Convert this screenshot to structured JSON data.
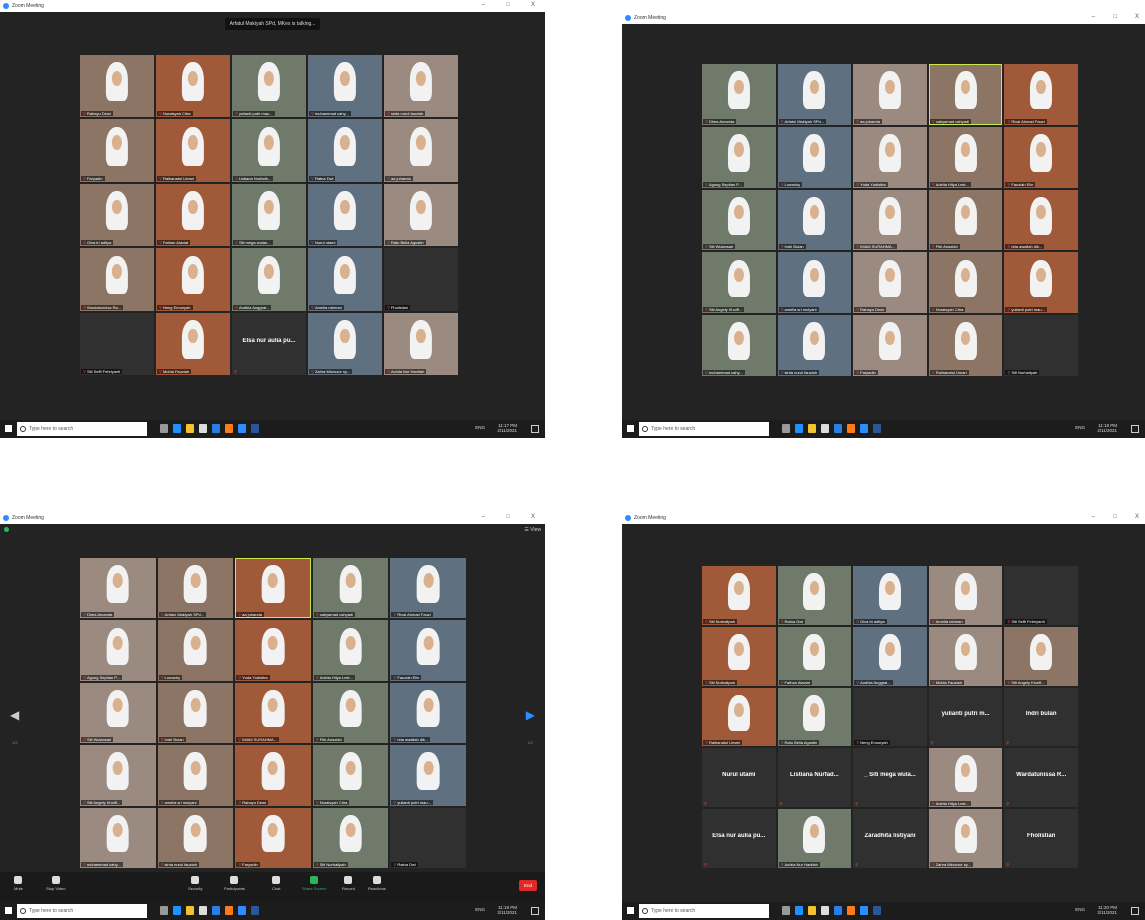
{
  "app_title": "Zoom Meeting",
  "window_controls": [
    "–",
    "□",
    "X"
  ],
  "taskbar": {
    "search_placeholder": "Type here to search",
    "lang": "ENG",
    "times": [
      "11:17 PM",
      "11:18 PM",
      "11:19 PM",
      "11:20 PM"
    ],
    "date": "2/11/2021"
  },
  "screens": [
    {
      "talking": "Arfatul Makiyah SPd, MKes is talking...",
      "tiles": [
        {
          "name": "Rahayu Dewi",
          "t": "video"
        },
        {
          "name": "Nuraisyah Citra",
          "t": "video"
        },
        {
          "name": "yulianti putri mau...",
          "t": "video"
        },
        {
          "name": "muhammad cahy...",
          "t": "video"
        },
        {
          "name": "sinta nurul fauziah",
          "t": "video"
        },
        {
          "name": "Faryadin",
          "t": "video"
        },
        {
          "name": "Raihanatul Umari",
          "t": "video"
        },
        {
          "name": "Listiana Nurfadh...",
          "t": "video"
        },
        {
          "name": "Ratna Dwi",
          "t": "video"
        },
        {
          "name": "aa juhanda",
          "t": "video"
        },
        {
          "name": "Giva tri aditya",
          "t": "video"
        },
        {
          "name": "Fathan Alaviat",
          "t": "video"
        },
        {
          "name": "Siti mega wulan...",
          "t": "video"
        },
        {
          "name": "Nurul utami",
          "t": "video"
        },
        {
          "name": "Ratu Bella Agustin",
          "t": "video"
        },
        {
          "name": "Wardatunnisa Ra...",
          "t": "video"
        },
        {
          "name": "Neng Emunyah",
          "t": "video"
        },
        {
          "name": "Audhia Anggrai...",
          "t": "video"
        },
        {
          "name": "Amelia rahman",
          "t": "video"
        },
        {
          "name": "Fholistian",
          "t": "empty"
        },
        {
          "name": "Siti Seffi Febriyanti",
          "t": "empty"
        },
        {
          "name": "Muhia Fauziah",
          "t": "video"
        },
        {
          "name": "",
          "t": "text",
          "big": "Elsa nur aulia pu..."
        },
        {
          "name": "Zahra Mirzozur sy...",
          "t": "video"
        },
        {
          "name": "Achila Nur Hanifah",
          "t": "video"
        }
      ]
    },
    {
      "tiles": [
        {
          "name": "Dhea Amanda",
          "t": "video"
        },
        {
          "name": "Arfatul Makiyah SPd...",
          "t": "video"
        },
        {
          "name": "aa juhanda",
          "t": "video"
        },
        {
          "name": "cahyamad cahyadi",
          "t": "video",
          "active": true
        },
        {
          "name": "Rivai Ahmad Fauzi",
          "t": "video"
        },
        {
          "name": "Agung Septian P...",
          "t": "video"
        },
        {
          "name": "Louwcky",
          "t": "video"
        },
        {
          "name": "Yuda Yudistira",
          "t": "video"
        },
        {
          "name": "Adelia Hilya Lest...",
          "t": "video"
        },
        {
          "name": "Fauziah Elin",
          "t": "video"
        },
        {
          "name": "Siti Wulansari",
          "t": "video"
        },
        {
          "name": "Indri Bulan",
          "t": "video"
        },
        {
          "name": "IMAM SURAHMA...",
          "t": "video"
        },
        {
          "name": "Fitri Anazlah",
          "t": "video"
        },
        {
          "name": "rida awaliah dlk...",
          "t": "video"
        },
        {
          "name": "Siti Angely Khoiff...",
          "t": "video"
        },
        {
          "name": "amelia sri mulyani",
          "t": "video"
        },
        {
          "name": "Rahayu Dewi",
          "t": "video"
        },
        {
          "name": "Nuraisyah Citra",
          "t": "video"
        },
        {
          "name": "yulianti putri mau...",
          "t": "video"
        },
        {
          "name": "muhammad cahy...",
          "t": "video"
        },
        {
          "name": "sinta nurul fauziah",
          "t": "video"
        },
        {
          "name": "Faryadin",
          "t": "video"
        },
        {
          "name": "Raihanatul Umari",
          "t": "video"
        },
        {
          "name": "Siti Nurhalipah",
          "t": "empty"
        }
      ]
    },
    {
      "view_label": "View",
      "page": "1/2",
      "tiles": [
        {
          "name": "Dhea Amanda",
          "t": "video"
        },
        {
          "name": "Arfatul Makiyah SPd...",
          "t": "video"
        },
        {
          "name": "aa juhanda",
          "t": "video",
          "active": true
        },
        {
          "name": "cahyamad cahyadi",
          "t": "video"
        },
        {
          "name": "Rivai Ahmad Fauzi",
          "t": "video"
        },
        {
          "name": "Agung Septian P...",
          "t": "video"
        },
        {
          "name": "Louwcky",
          "t": "video"
        },
        {
          "name": "Yuda Yudistira",
          "t": "video"
        },
        {
          "name": "Adelia Hilya Lest...",
          "t": "video"
        },
        {
          "name": "Fauziah Elin",
          "t": "video"
        },
        {
          "name": "Siti Wulansari",
          "t": "video"
        },
        {
          "name": "Indri Bulan",
          "t": "video"
        },
        {
          "name": "IMAM SURAHMA...",
          "t": "video"
        },
        {
          "name": "Fitri Anazlah",
          "t": "video"
        },
        {
          "name": "rida awaliah dlk...",
          "t": "video"
        },
        {
          "name": "Siti Angely Khoiff...",
          "t": "video"
        },
        {
          "name": "amelia sri mulyani",
          "t": "video"
        },
        {
          "name": "Rahayu Dewi",
          "t": "video"
        },
        {
          "name": "Nuraisyah Citra",
          "t": "video"
        },
        {
          "name": "yulianti putri mau...",
          "t": "video"
        },
        {
          "name": "muhammad cahy...",
          "t": "video"
        },
        {
          "name": "sinta nurul fauziah",
          "t": "video"
        },
        {
          "name": "Faryadin",
          "t": "video"
        },
        {
          "name": "Siti Nurhalipah",
          "t": "video"
        },
        {
          "name": "Ratna Dwi",
          "t": "empty"
        }
      ],
      "controls": [
        "Mute",
        "Stop Video",
        "Security",
        "Participants",
        "Chat",
        "Share Screen",
        "Record",
        "Reactions"
      ],
      "participant_count": "44",
      "end_label": "End"
    },
    {
      "tiles": [
        {
          "name": "Siti Nurhalipah",
          "t": "video"
        },
        {
          "name": "Ratna Dwi",
          "t": "video"
        },
        {
          "name": "Giva tri aditya",
          "t": "video"
        },
        {
          "name": "Amelia rahman",
          "t": "video"
        },
        {
          "name": "Siti Seffi Febriyanti",
          "t": "empty"
        },
        {
          "name": "Siti Nurhalipah",
          "t": "video"
        },
        {
          "name": "Fathan Alaviat",
          "t": "video"
        },
        {
          "name": "Audhia Anggrai...",
          "t": "video"
        },
        {
          "name": "Muhia Fauziah",
          "t": "video"
        },
        {
          "name": "Siti Angely Khoiff...",
          "t": "video"
        },
        {
          "name": "Raihanatul Umari",
          "t": "video"
        },
        {
          "name": "Ratu Bella Agustin",
          "t": "video"
        },
        {
          "name": "Neng Emunyah",
          "t": "empty"
        },
        {
          "name": "",
          "t": "text",
          "big": "yulianti putri m..."
        },
        {
          "name": "",
          "t": "text",
          "big": "Indri bulan"
        },
        {
          "name": "",
          "t": "text",
          "big": "Nurul utami"
        },
        {
          "name": "",
          "t": "text",
          "big": "Listiana Nurfad..."
        },
        {
          "name": "",
          "t": "text",
          "big": "_ Siti mega wula..."
        },
        {
          "name": "Adelia Hilya Lest...",
          "t": "video"
        },
        {
          "name": "",
          "t": "text",
          "big": "Wardatunissa R..."
        },
        {
          "name": "",
          "t": "text",
          "big": "Elsa nur aulia pu..."
        },
        {
          "name": "Achila Nur Hanifah",
          "t": "video"
        },
        {
          "name": "",
          "t": "text",
          "big": "Zaradhita listiyani"
        },
        {
          "name": "Zahra Mirzozur sy...",
          "t": "video"
        },
        {
          "name": "",
          "t": "text",
          "big": "Fholistian"
        }
      ]
    }
  ]
}
